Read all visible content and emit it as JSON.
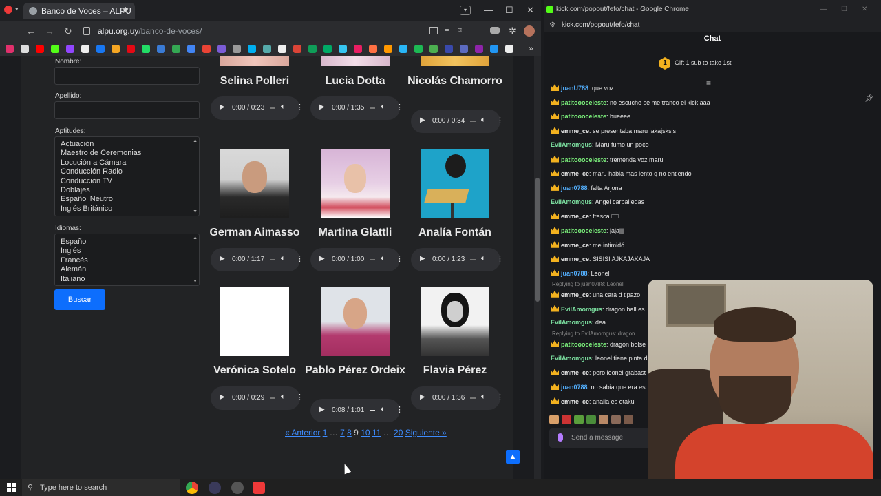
{
  "browser": {
    "tab_title": "Banco de Voces – ALPU",
    "url_domain": "alpu.org.uy",
    "url_path": "/banco-de-voces/",
    "controls": {
      "minimize": "—",
      "maximize": "☐",
      "close": "✕",
      "new_tab": "+"
    }
  },
  "form": {
    "nombre_label": "Nombre:",
    "apellido_label": "Apellido:",
    "aptitudes_label": "Aptitudes:",
    "aptitudes": [
      "Actuación",
      "Maestro de Ceremonias",
      "Locución a Cámara",
      "Conducción Radio",
      "Conducción TV",
      "Doblajes",
      "Español Neutro",
      "Inglés Británico"
    ],
    "idiomas_label": "Idiomas:",
    "idiomas": [
      "Español",
      "Inglés",
      "Francés",
      "Alemán",
      "Italiano"
    ],
    "search_button": "Buscar"
  },
  "voices": [
    {
      "name": "Selina Polleri",
      "time": "0:00 / 0:23"
    },
    {
      "name": "Lucia Dotta",
      "time": "0:00 / 1:35"
    },
    {
      "name": "Nicolás Chamorro",
      "time": "0:00 / 0:34"
    },
    {
      "name": "German Aimasso",
      "time": "0:00 / 1:17"
    },
    {
      "name": "Martina Glattli",
      "time": "0:00 / 1:00"
    },
    {
      "name": "Analía Fontán",
      "time": "0:00 / 1:23"
    },
    {
      "name": "Verónica Sotelo",
      "time": "0:00 / 0:29"
    },
    {
      "name": "Pablo Pérez Ordeix",
      "time": "0:08 / 1:01"
    },
    {
      "name": "Flavia Pérez",
      "time": "0:00 / 1:36"
    }
  ],
  "pagination": {
    "prev": "« Anterior",
    "p1": "1",
    "dots1": "…",
    "p7": "7",
    "p8": "8",
    "current": "9",
    "p10": "10",
    "p11": "11",
    "dots2": "…",
    "p20": "20",
    "next": "Siguiente »"
  },
  "chat": {
    "window_title": "kick.com/popout/fefo/chat - Google Chrome",
    "url": "kick.com/popout/fefo/chat",
    "header": "Chat",
    "gift_badge": "1",
    "gift_text": "Gift 1 sub to take 1st",
    "input_placeholder": "Send a message",
    "messages": [
      {
        "user": "juanU788",
        "text": "que voz",
        "color": "#53b0ff",
        "crown": true
      },
      {
        "user": "patitoooceleste",
        "text": "no escuche se me tranco el kick aaa",
        "color": "#7cf27c",
        "crown": true
      },
      {
        "user": "patitoooceleste",
        "text": "bueeee",
        "color": "#7cf27c",
        "crown": true
      },
      {
        "user": "emme_ce",
        "text": "se presentaba maru jakajsksjs",
        "color": "#e8e8e8",
        "crown": true
      },
      {
        "user": "EvilAmomgus",
        "text": "Maru fumo un poco",
        "color": "#7ce0a0",
        "crown": false
      },
      {
        "user": "patitoooceleste",
        "text": "tremenda voz maru",
        "color": "#7cf27c",
        "crown": true
      },
      {
        "user": "emme_ce",
        "text": "maru habla mas lento q no entiendo",
        "color": "#e8e8e8",
        "crown": true
      },
      {
        "user": "juan0788",
        "text": "falta Arjona",
        "color": "#53b0ff",
        "crown": true
      },
      {
        "user": "EvilAmomgus",
        "text": "Angel carballedas",
        "color": "#7ce0a0",
        "crown": false
      },
      {
        "user": "emme_ce",
        "text": "fresca □□",
        "color": "#e8e8e8",
        "crown": true
      },
      {
        "user": "patitoooceleste",
        "text": "jajajjj",
        "color": "#7cf27c",
        "crown": true
      },
      {
        "user": "emme_ce",
        "text": "me intimidó",
        "color": "#e8e8e8",
        "crown": true
      },
      {
        "user": "emme_ce",
        "text": "SISISI AJKAJAKAJA",
        "color": "#e8e8e8",
        "crown": true
      },
      {
        "user": "juan0788",
        "text": "Leonel",
        "color": "#53b0ff",
        "crown": true
      },
      {
        "user": "emme_ce",
        "text": "una cara d tipazo",
        "color": "#e8e8e8",
        "crown": true,
        "reply": "Replying to juan0788: Leonel"
      },
      {
        "user": "EvilAmomgus",
        "text": "dragon ball es",
        "color": "#7ce0a0",
        "crown": true
      },
      {
        "user": "EvilAmomgus",
        "text": "dea",
        "color": "#7ce0a0",
        "crown": false
      },
      {
        "user": "patitoooceleste",
        "text": "dragon bolse",
        "color": "#7cf27c",
        "crown": true,
        "reply": "Replying to EvilAmomgus: dragon"
      },
      {
        "user": "EvilAmomgus",
        "text": "leonel tiene pinta d",
        "color": "#7ce0a0",
        "crown": false
      },
      {
        "user": "emme_ce",
        "text": "pero leonel grabast",
        "color": "#e8e8e8",
        "crown": true
      },
      {
        "user": "juan0788",
        "text": "no sabia que era es",
        "color": "#53b0ff",
        "crown": true
      },
      {
        "user": "emme_ce",
        "text": "analia es otaku",
        "color": "#e8e8e8",
        "crown": true
      }
    ]
  },
  "taskbar": {
    "search_placeholder": "Type here to search"
  }
}
